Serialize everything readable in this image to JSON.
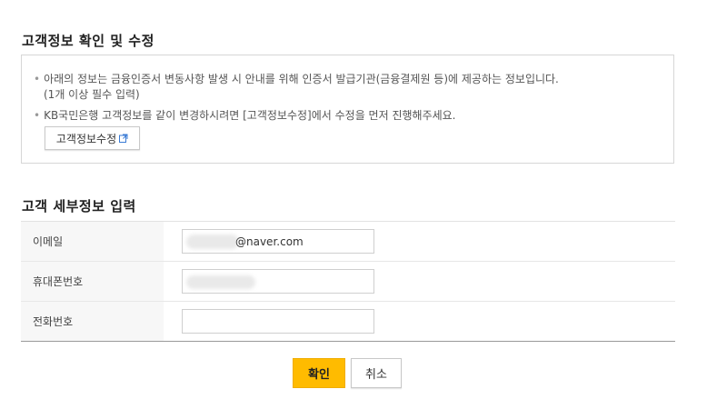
{
  "section1": {
    "title": "고객정보 확인 및 수정",
    "notice": {
      "line1": "아래의 정보는 금융인증서 변동사항 발생 시 안내를 위해 인증서 발급기관(금융결제원 등)에 제공하는 정보입니다.",
      "line1b": "(1개 이상 필수 입력)",
      "line2": "KB국민은행 고객정보를 같이 변경하시려면 [고객정보수정]에서 수정을 먼저 진행해주세요.",
      "bullet": "•"
    },
    "edit_button_label": "고객정보수정",
    "edit_button_icon": "external-link-icon"
  },
  "section2": {
    "title": "고객 세부정보 입력",
    "rows": [
      {
        "label": "이메일",
        "value": "@naver.com"
      },
      {
        "label": "휴대폰번호",
        "value": ""
      },
      {
        "label": "전화번호",
        "value": ""
      }
    ]
  },
  "buttons": {
    "confirm": "확인",
    "cancel": "취소"
  },
  "colors": {
    "confirm_bg": "#ffbb00",
    "link_icon": "#3a7bd5"
  }
}
